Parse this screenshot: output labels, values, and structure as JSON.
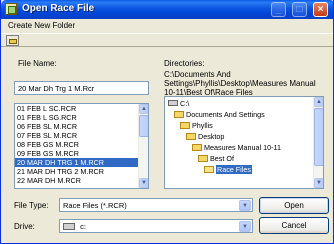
{
  "window": {
    "title": "Open Race File"
  },
  "titlebar_buttons": {
    "minimize": "_",
    "maximize": "□",
    "close": "×"
  },
  "menu": {
    "items": [
      {
        "label": "Create New Folder"
      }
    ]
  },
  "filename": {
    "label": "File Name:",
    "value": "20 Mar Dh Trg 1 M.Rcr",
    "files": [
      {
        "name": "01 FEB L SC.RCR",
        "selected": false
      },
      {
        "name": "01 FEB L SG.RCR",
        "selected": false
      },
      {
        "name": "06 FEB SL M.RCR",
        "selected": false
      },
      {
        "name": "07 FEB SL M.RCR",
        "selected": false
      },
      {
        "name": "08 FEB GS M.RCR",
        "selected": false
      },
      {
        "name": "09 FEB GS M.RCR",
        "selected": false
      },
      {
        "name": "20 MAR DH TRG 1 M.RCR",
        "selected": true
      },
      {
        "name": "21 MAR DH TRG 2 M.RCR",
        "selected": false
      },
      {
        "name": "22 MAR DH M.RCR",
        "selected": false
      }
    ]
  },
  "directories": {
    "label": "Directories:",
    "path_line1": "C:\\Documents And",
    "path_line2": "Settings\\Phyllis\\Desktop\\Measures Manual",
    "path_line3": "10-11\\Best Of\\Race Files",
    "tree": [
      {
        "name": "C:\\",
        "type": "drive",
        "selected": false
      },
      {
        "name": "Documents And Settings",
        "type": "folder",
        "selected": false
      },
      {
        "name": "Phyllis",
        "type": "folder",
        "selected": false
      },
      {
        "name": "Desktop",
        "type": "folder",
        "selected": false
      },
      {
        "name": "Measures Manual 10-11",
        "type": "folder",
        "selected": false
      },
      {
        "name": "Best Of",
        "type": "folder",
        "selected": false
      },
      {
        "name": "Race Files",
        "type": "folder-open",
        "selected": true
      }
    ]
  },
  "filetype": {
    "label": "File Type:",
    "value": "Race Files (*.RCR)"
  },
  "drive": {
    "label": "Drive:",
    "value": "c:"
  },
  "buttons": {
    "open": "Open",
    "cancel": "Cancel"
  }
}
